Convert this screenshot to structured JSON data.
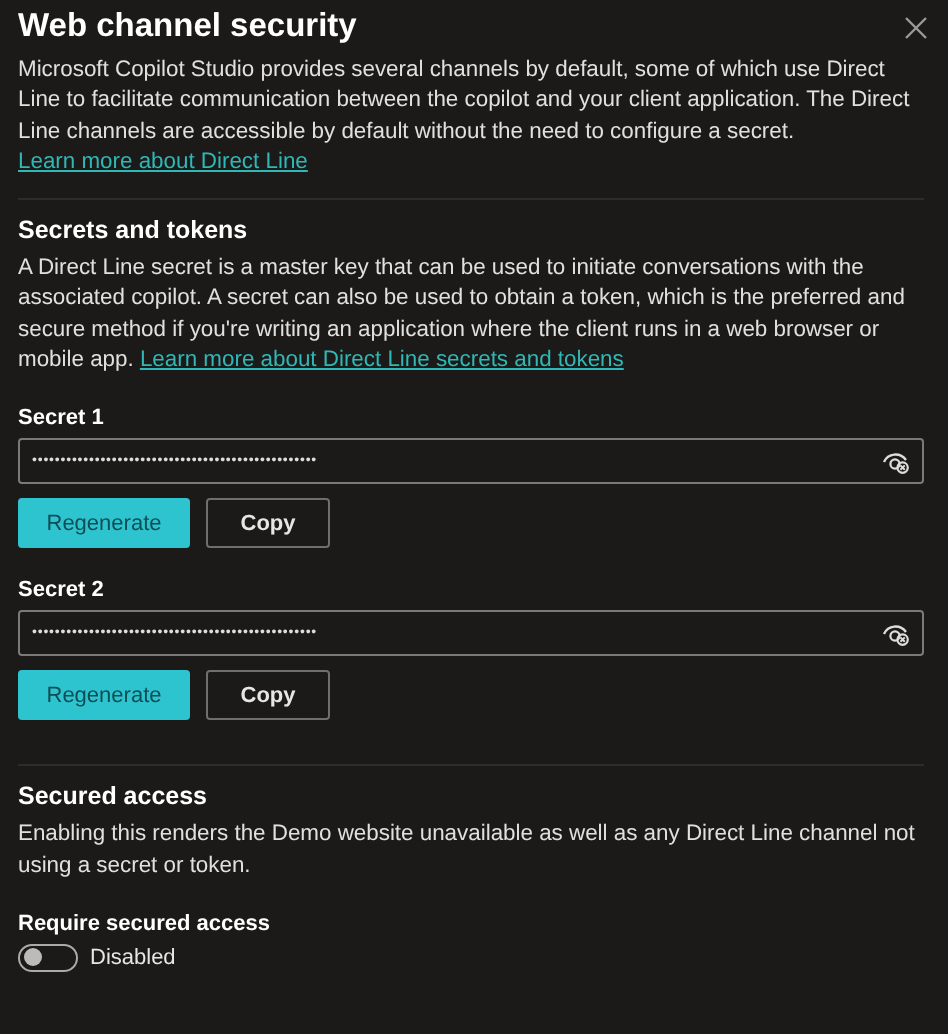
{
  "title": "Web channel security",
  "intro": {
    "text": "Microsoft Copilot Studio provides several channels by default, some of which use Direct Line to facilitate communication between the copilot and your client application. The Direct Line channels are accessible by default without the need to configure a secret.",
    "link": "Learn more about Direct Line"
  },
  "secrets_section": {
    "heading": "Secrets and tokens",
    "text": "A Direct Line secret is a master key that can be used to initiate conversations with the associated copilot. A secret can also be used to obtain a token, which is the preferred and secure method if you're writing an application where the client runs in a web browser or mobile app.",
    "link": "Learn more about Direct Line secrets and tokens"
  },
  "secrets": [
    {
      "label": "Secret 1",
      "value": "••••••••••••••••••••••••••••••••••••••••••••••••••",
      "buttons": [
        "Regenerate",
        "Copy"
      ]
    },
    {
      "label": "Secret 2",
      "value": "••••••••••••••••••••••••••••••••••••••••••••••••••",
      "buttons": [
        "Regenerate",
        "Copy"
      ]
    }
  ],
  "secured_access": {
    "heading": "Secured access",
    "text": "Enabling this renders the Demo website unavailable as well as any Direct Line channel not using a secret or token.",
    "toggle_label": "Require secured access",
    "on": false,
    "state_text": "Disabled"
  }
}
